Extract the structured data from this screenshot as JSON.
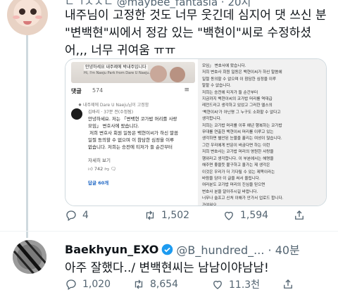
{
  "tweet1": {
    "header": "ㄴㄱㅅㅈㄷ @maybee_fantasia · 20시",
    "text": "내주님이 고정한 것도 너무 웃긴데 심지어 댓 쓰신 분 \"변백현\"씨에서 정감 있는 \"백현이\"씨로 수정하셨어,,, 너무 귀여움 ㅠㅠ",
    "media_left": {
      "video_caption": "안녕하세요 내주제에 박내주입니다",
      "video_caption_en": "Hi, I'm Naeju Park from Dare U Naeju.",
      "comments_label": "댓글",
      "comments_count": "574",
      "sort_icon": "≡",
      "pinned": "✸ 내주제에 Dare U Naeju님이 고정함",
      "comment_meta": "김바리 · 37분 전(수정됨)",
      "comment_body": "안녕하세요. 저는 「변백현 코가밥 머리를 사랑\n모임」 변호사에 왔습니다.\n 저희 변호사 회원 일동은 백현이씨가 하신 말씀\n일절 동의할 수 없으며 이 참담한 심정을 이루\n없습니다. 저희는 승전에 티저가 들 순간부터",
      "read_more": "자세히 보기",
      "likes": "742",
      "replies_link": "답글 60개"
    },
    "media_right": {
      "text": "모임」 변호사에 왔습니다.\n저희 변호사 회원 일동은 백현이씨가 하신 말씀에\n일절 동의할 수 없으며 이 참담한 심정을 이루\n말할 수 없습니다.\n저희는 승전에 티저가 들 순간부터\n지금까지 백현이씨의 코가밥 머리를 역대급\n레전드라고 생각하고 있었고 그러한 엘스의\n'백현이씨'가 아닌명 그 누구도 소화할 수 없다고\n생각합니다.\n저희는 코가밥 머리를 이후 예년 행복하는 코가밥\n무대를 연출한 백현이씨 머리를 이루고 있는\n생각하면 별안된 눈물을 흘리는 여성이 많습니다.\n그런 우리에게 반문이 바굼다면 하는 이런\n저희 변호사는 코가밥 머리의 영원한 사랑을\n행위라고 생각합니다. 이 부분에서는 해명을\n해주면 좋을듯 불구하고 올가는 제 생각은\n이것은 우리가 더 기다릴 수 있는 제목이라는\n바람을 담아 이 글을 써서 올립니다.\n여러분도 코가밥 머리의 진심을 믿으면\n변호사 분을 알아주시길 바랍니다.\n너무나 슬프고 신처 이해가 안가서 업로드 합니다.\n가여워요.\n백현이씨는 엑스엘 뿐만 아니라 코가밥 머리에 진심인"
    },
    "actions": {
      "replies": "4",
      "retweets": "1,502",
      "likes": "1,594"
    }
  },
  "tweet2": {
    "name": "Baekhyun_EXO",
    "handle": "@B_hundred_... · 40분",
    "text": "아주 잘했다../ 변백현씨는 남남이야남남!",
    "actions": {
      "replies": "1,020",
      "retweets": "8,654",
      "likes": "11.3천"
    }
  },
  "colors": {
    "verified": "#1d9bf0",
    "muted": "#536471",
    "link": "#1e66c4"
  }
}
